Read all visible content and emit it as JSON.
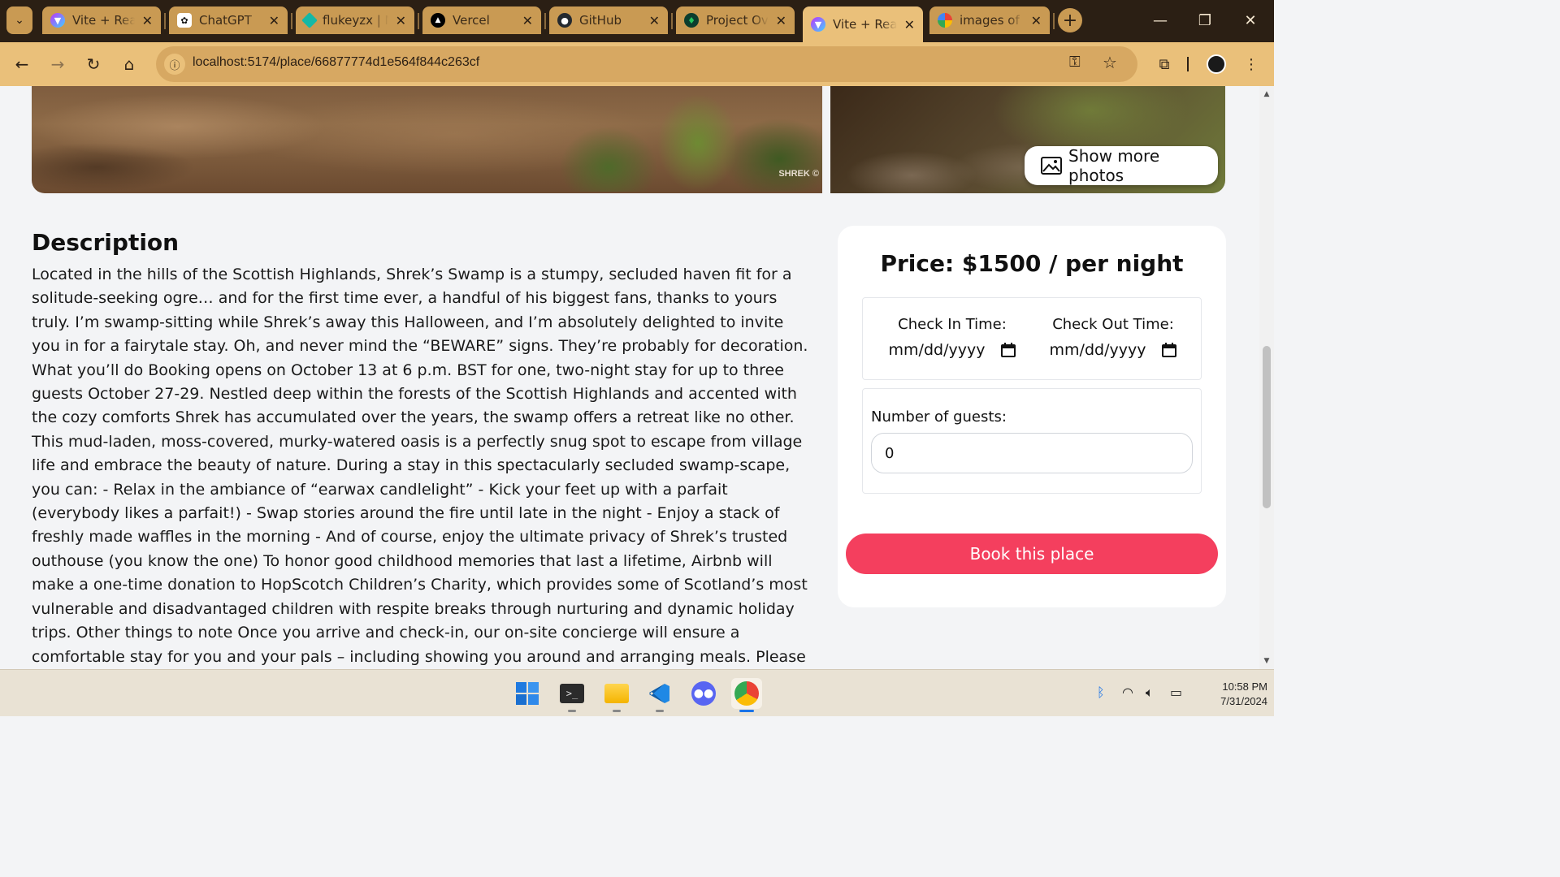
{
  "browser": {
    "tabs": [
      {
        "title": "Vite + React",
        "icon": "vite-icon",
        "active": false
      },
      {
        "title": "ChatGPT",
        "icon": "chatgpt-icon",
        "active": false
      },
      {
        "title": "flukeyzx | N",
        "icon": "diamond-icon",
        "active": false
      },
      {
        "title": "Vercel",
        "icon": "vercel-icon",
        "active": false
      },
      {
        "title": "GitHub",
        "icon": "github-icon",
        "active": false
      },
      {
        "title": "Project Ov",
        "icon": "mongodb-icon",
        "active": false
      },
      {
        "title": "Vite + React",
        "icon": "vite-icon",
        "active": true
      },
      {
        "title": "images of",
        "icon": "google-icon",
        "active": false
      }
    ],
    "url": "localhost:5174/place/66877774d1e564f844c263cf"
  },
  "gallery": {
    "show_more_label": "Show more photos",
    "photo_credit": "SHREK ©"
  },
  "description": {
    "heading": "Description",
    "text": "Located in the hills of the Scottish Highlands, Shrek’s Swamp is a stumpy, secluded haven fit for a solitude-seeking ogre… and for the first time ever, a handful of his biggest fans, thanks to yours truly. I’m swamp-sitting while Shrek’s away this Halloween, and I’m absolutely delighted to invite you in for a fairytale stay. Oh, and never mind the “BEWARE” signs. They’re probably for decoration. What you’ll do Booking opens on October 13 at 6 p.m. BST for one, two-night stay for up to three guests October 27-29. Nestled deep within the forests of the Scottish Highlands and accented with the cozy comforts Shrek has accumulated over the years, the swamp offers a retreat like no other. This mud-laden, moss-covered, murky-watered oasis is a perfectly snug spot to escape from village life and embrace the beauty of nature. During a stay in this spectacularly secluded swamp-scape, you can: - Relax in the ambiance of “earwax candlelight” - Kick your feet up with a parfait (everybody likes a parfait!) - Swap stories around the fire until late in the night - Enjoy a stack of freshly made waffles in the morning - And of course, enjoy the ultimate privacy of Shrek’s trusted outhouse (you know the one) To honor good childhood memories that last a lifetime, Airbnb will make a one-time donation to HopScotch Children’s Charity, which provides some of Scotland’s most vulnerable and disadvantaged children with respite breaks through nurturing and dynamic holiday trips. Other things to note Once you arrive and check-in, our on-site concierge will ensure a comfortable stay for you and your pals – including showing you around and arranging meals. Please note that toilet, sink and shower facilities will be located off-site, approximately 20 meters away from Shrek’s Swamp. Booking Rules: - In order to request to"
  },
  "booking": {
    "price_label": "Price: $1500 / per night",
    "check_in_label": "Check In Time:",
    "check_in_placeholder": "mm/dd/yyyy",
    "check_out_label": "Check Out Time:",
    "check_out_placeholder": "mm/dd/yyyy",
    "guests_label": "Number of guests:",
    "guests_value": "0",
    "book_button": "Book this place",
    "accent_color": "#f43f5e"
  },
  "taskbar": {
    "apps": [
      "windows-start",
      "terminal",
      "file-explorer",
      "vscode",
      "discord",
      "chrome"
    ],
    "time": "10:58 PM",
    "date": "7/31/2024"
  }
}
